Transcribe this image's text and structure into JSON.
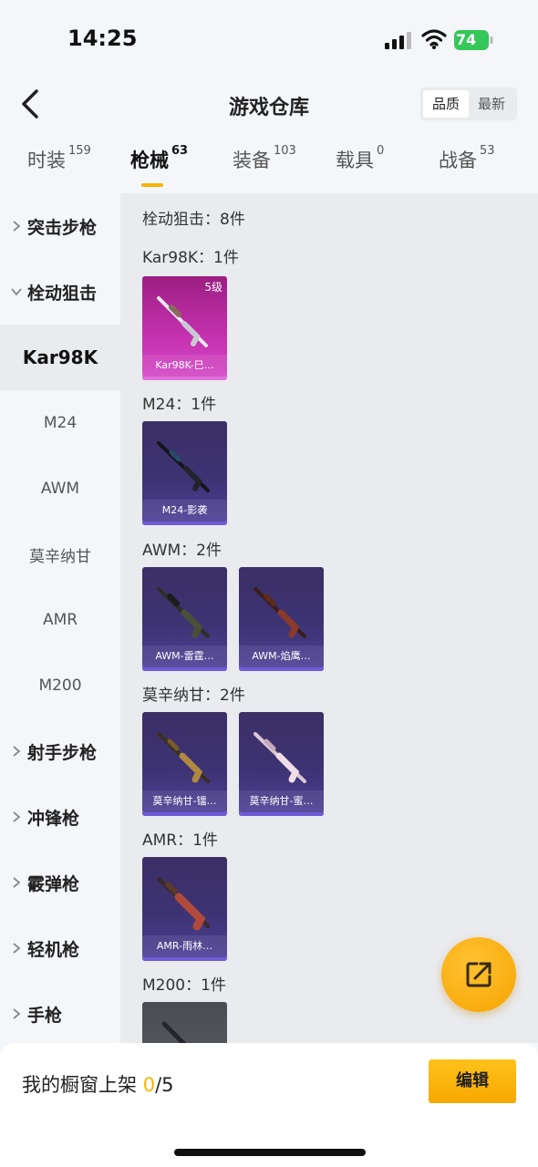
{
  "status_bar": {
    "time": "14:25",
    "battery": "74"
  },
  "header": {
    "title": "游戏仓库",
    "sort_options": [
      "品质",
      "最新"
    ]
  },
  "tabs": [
    {
      "label": "时装",
      "count": "159"
    },
    {
      "label": "枪械",
      "count": "63"
    },
    {
      "label": "装备",
      "count": "103"
    },
    {
      "label": "载具",
      "count": "0"
    },
    {
      "label": "战备",
      "count": "53"
    }
  ],
  "sidebar": [
    {
      "label": "突击步枪"
    },
    {
      "label": "栓动狙击"
    },
    {
      "label": "Kar98K"
    },
    {
      "label": "M24"
    },
    {
      "label": "AWM"
    },
    {
      "label": "莫辛纳甘"
    },
    {
      "label": "AMR"
    },
    {
      "label": "M200"
    },
    {
      "label": "射手步枪"
    },
    {
      "label": "冲锋枪"
    },
    {
      "label": "霰弹枪"
    },
    {
      "label": "轻机枪"
    },
    {
      "label": "手枪"
    }
  ],
  "content": {
    "section_title": "栓动狙击：8件",
    "groups": [
      {
        "header": "Kar98K：1件",
        "items": [
          {
            "name": "Kar98K-巳…",
            "level": "5级"
          }
        ]
      },
      {
        "header": "M24：1件",
        "items": [
          {
            "name": "M24-影袭"
          }
        ]
      },
      {
        "header": "AWM：2件",
        "items": [
          {
            "name": "AWM-雷霆…"
          },
          {
            "name": "AWM-焰鹰…"
          }
        ]
      },
      {
        "header": "莫辛纳甘：2件",
        "items": [
          {
            "name": "莫辛纳甘-镭…"
          },
          {
            "name": "莫辛纳甘-蜜…"
          }
        ]
      },
      {
        "header": "AMR：1件",
        "items": [
          {
            "name": "AMR-雨林…"
          }
        ]
      },
      {
        "header": "M200：1件",
        "items": []
      }
    ]
  },
  "bottom_bar": {
    "label": "我的橱窗上架",
    "current": "0",
    "total": "/5",
    "edit_label": "编辑"
  },
  "colors": {
    "accent": "#f5b400",
    "card_purple": "#3d3373",
    "card_pink": "#c632b0"
  }
}
